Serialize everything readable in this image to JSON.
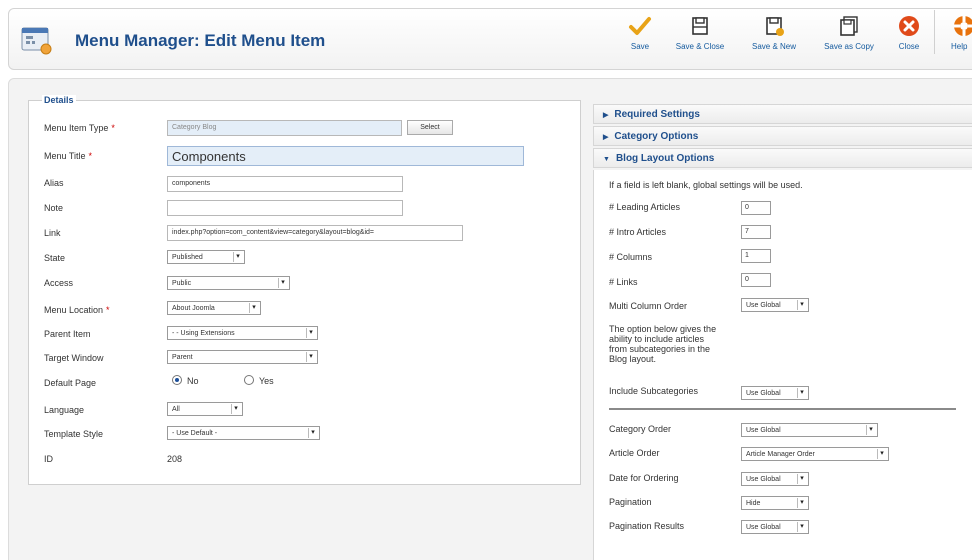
{
  "header": {
    "title": "Menu Manager: Edit Menu Item",
    "toolbar": [
      {
        "label": "Save",
        "icon": "save-icon"
      },
      {
        "label": "Save & Close",
        "icon": "save-close-icon"
      },
      {
        "label": "Save & New",
        "icon": "save-new-icon"
      },
      {
        "label": "Save as Copy",
        "icon": "save-copy-icon"
      },
      {
        "label": "Close",
        "icon": "close-icon"
      },
      {
        "label": "Help",
        "icon": "help-icon"
      }
    ]
  },
  "details": {
    "legend": "Details",
    "menu_item_type": {
      "label": "Menu Item Type",
      "value": "Category Blog",
      "button": "Select"
    },
    "menu_title": {
      "label": "Menu Title",
      "value": "Components"
    },
    "alias": {
      "label": "Alias",
      "value": "components"
    },
    "note": {
      "label": "Note",
      "value": ""
    },
    "link": {
      "label": "Link",
      "value": "index.php?option=com_content&view=category&layout=blog&id="
    },
    "state": {
      "label": "State",
      "value": "Published"
    },
    "access": {
      "label": "Access",
      "value": "Public"
    },
    "menu_location": {
      "label": "Menu Location",
      "value": "About Joomla"
    },
    "parent_item": {
      "label": "Parent Item",
      "value": "- - Using Extensions"
    },
    "target_window": {
      "label": "Target Window",
      "value": "Parent"
    },
    "default_page": {
      "label": "Default Page",
      "no": "No",
      "yes": "Yes"
    },
    "language": {
      "label": "Language",
      "value": "All"
    },
    "template_style": {
      "label": "Template Style",
      "value": "- Use Default -"
    },
    "id": {
      "label": "ID",
      "value": "208"
    },
    "required_mark": "*"
  },
  "panels": {
    "required_settings": "Required Settings",
    "category_options": "Category Options",
    "blog_layout_options": "Blog Layout Options"
  },
  "blog": {
    "intro": "If a field is left blank, global settings will be used.",
    "leading_articles": {
      "label": "# Leading Articles",
      "value": "0"
    },
    "intro_articles": {
      "label": "# Intro Articles",
      "value": "7"
    },
    "columns": {
      "label": "# Columns",
      "value": "1"
    },
    "links": {
      "label": "# Links",
      "value": "0"
    },
    "multi_column_order": {
      "label": "Multi Column Order",
      "value": "Use Global"
    },
    "note_line1": "The option below gives the",
    "note_line2": "ability to include articles",
    "note_line3": "from subcategories in the",
    "note_line4": "Blog layout.",
    "include_subcategories": {
      "label": "Include Subcategories",
      "value": "Use Global"
    },
    "category_order": {
      "label": "Category Order",
      "value": "Use Global"
    },
    "article_order": {
      "label": "Article Order",
      "value": "Article Manager Order"
    },
    "date_for_ordering": {
      "label": "Date for Ordering",
      "value": "Use Global"
    },
    "pagination": {
      "label": "Pagination",
      "value": "Hide"
    },
    "pagination_results": {
      "label": "Pagination Results",
      "value": "Use Global"
    }
  },
  "colors": {
    "accent": "#1f4f8c",
    "required": "#cc0000",
    "save": "#e8a317",
    "close": "#e04a1a"
  }
}
